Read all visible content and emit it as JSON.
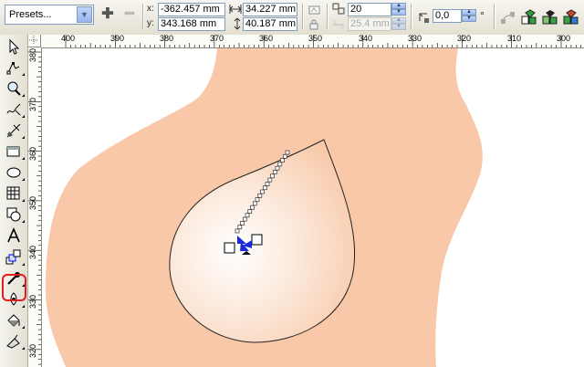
{
  "propbar": {
    "presets_label": "Presets...",
    "x_label": "x:",
    "y_label": "y:",
    "x_value": "-362.457 mm",
    "y_value": "343.168 mm",
    "width_value": "34.227 mm",
    "height_value": "40.187 mm",
    "steps_value": "20",
    "spacing_value": "25.4 mm",
    "angle_value": "0,0",
    "degree_symbol": "°"
  },
  "ruler": {
    "horizontal_ticks": [
      "400",
      "390",
      "380",
      "370",
      "360",
      "350",
      "340",
      "330",
      "320",
      "310",
      "300"
    ],
    "vertical_ticks": [
      "380",
      "370",
      "360",
      "350",
      "340",
      "330",
      "320"
    ]
  },
  "toolbox": {
    "tools": [
      "pick-tool",
      "shape-tool",
      "zoom-tool",
      "freehand-tool",
      "smart-fill-tool",
      "rectangle-tool",
      "ellipse-tool",
      "graph-paper-tool",
      "basic-shapes-tool",
      "text-tool",
      "interactive-blend-tool",
      "eyedropper-tool",
      "outline-tool",
      "fill-tool",
      "interactive-fill-tool"
    ],
    "highlighted": "interactive-blend-tool"
  },
  "colors": {
    "skin": "#f8c8a8",
    "blend_center": "#ffffff",
    "handle_accent": "#1a2ad8",
    "highlight_ring": "#e0201e"
  }
}
